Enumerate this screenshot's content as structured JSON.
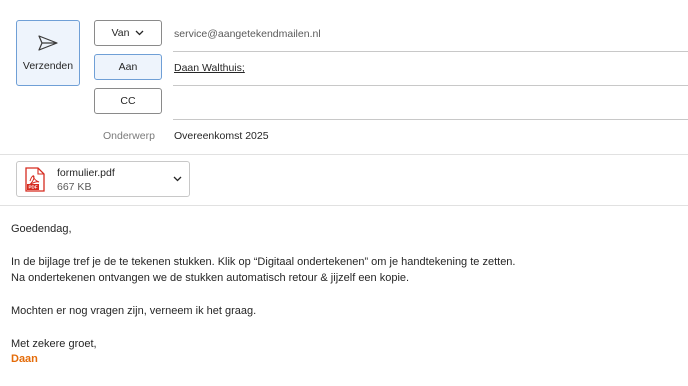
{
  "toolbar": {
    "send_label": "Verzenden"
  },
  "header": {
    "from_button": "Van",
    "from_address": "service@aangetekendmailen.nl",
    "to_button": "Aan",
    "to_recipient": "Daan Walthuis;",
    "cc_button": "CC",
    "cc_value": "",
    "subject_label": "Onderwerp",
    "subject_value": "Overeenkomst 2025"
  },
  "attachment": {
    "name": "formulier.pdf",
    "size": "667 KB",
    "type_badge": "PDF"
  },
  "body": {
    "greeting": "Goedendag,",
    "line1": "In de bijlage tref je de te tekenen stukken. Klik op “Digitaal ondertekenen” om je handtekening te zetten.",
    "line2": "Na ondertekenen ontvangen we de stukken automatisch retour & jijzelf een kopie.",
    "line3": "Mochten er nog vragen zijn, verneem ik het graag.",
    "closing": "Met zekere groet,",
    "signature": "Daan"
  },
  "colors": {
    "accent_border": "#6f9fd6",
    "accent_bg": "#eef4fc",
    "signature": "#e46c0a",
    "pdf_red": "#d62b1f"
  },
  "icons": {
    "send": "paper-plane-icon",
    "from_dropdown": "chevron-down-icon",
    "attachment": "pdf-file-icon",
    "attachment_menu": "chevron-down-icon"
  }
}
